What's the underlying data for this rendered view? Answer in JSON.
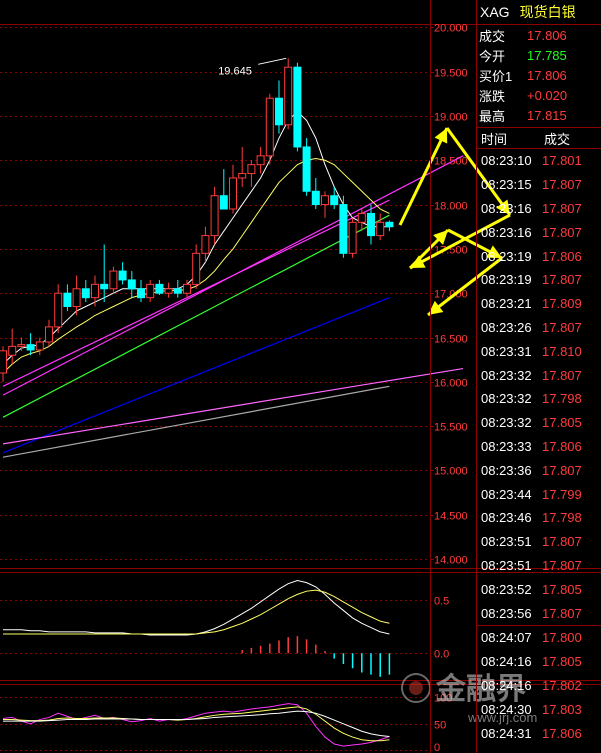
{
  "colors": {
    "background": "#000000",
    "grid": "#8b0000",
    "up_candle": "#ff3b3b",
    "down_candle": "#00ffff",
    "ma5": "#ffffff",
    "ma10": "#ffff66",
    "ma20": "#33ff33",
    "ma40": "#ff33ff",
    "ma60": "#0000ff",
    "ma120": "#ff66ff",
    "ma240": "#aaaaaa",
    "annotation_arrow": "#ffff00",
    "quote_up": "#ff3b3b",
    "quote_green": "#22ff22"
  },
  "header": {
    "symbol": "XAG",
    "name": "现货白银"
  },
  "quote": [
    {
      "label": "成交",
      "value": "17.806",
      "color": "red"
    },
    {
      "label": "今开",
      "value": "17.785",
      "color": "green"
    },
    {
      "label": "买价1",
      "value": "17.806",
      "color": "red"
    },
    {
      "label": "涨跌",
      "value": "+0.020",
      "color": "red"
    },
    {
      "label": "最高",
      "value": "17.815",
      "color": "red"
    }
  ],
  "ticks_header": {
    "time": "时间",
    "price": "成交"
  },
  "ticks": [
    {
      "time": "08:23:10",
      "price": "17.801"
    },
    {
      "time": "08:23:15",
      "price": "17.807"
    },
    {
      "time": "08:23:16",
      "price": "17.807"
    },
    {
      "time": "08:23:16",
      "price": "17.807"
    },
    {
      "time": "08:23:19",
      "price": "17.806"
    },
    {
      "time": "08:23:19",
      "price": "17.807"
    },
    {
      "time": "08:23:21",
      "price": "17.809"
    },
    {
      "time": "08:23:26",
      "price": "17.807"
    },
    {
      "time": "08:23:31",
      "price": "17.810"
    },
    {
      "time": "08:23:32",
      "price": "17.807"
    },
    {
      "time": "08:23:32",
      "price": "17.798"
    },
    {
      "time": "08:23:32",
      "price": "17.805"
    },
    {
      "time": "08:23:33",
      "price": "17.806"
    },
    {
      "time": "08:23:36",
      "price": "17.807"
    },
    {
      "time": "08:23:44",
      "price": "17.799"
    },
    {
      "time": "08:23:46",
      "price": "17.798"
    },
    {
      "time": "08:23:51",
      "price": "17.807"
    },
    {
      "time": "08:23:51",
      "price": "17.807"
    },
    {
      "time": "08:23:52",
      "price": "17.805"
    },
    {
      "time": "08:23:56",
      "price": "17.807"
    },
    {
      "time": "08:24:07",
      "price": "17.800"
    },
    {
      "time": "08:24:16",
      "price": "17.805"
    },
    {
      "time": "08:24:16",
      "price": "17.802"
    },
    {
      "time": "08:24:30",
      "price": "17.803"
    },
    {
      "time": "08:24:31",
      "price": "17.806"
    }
  ],
  "watermark": {
    "text": "金融界",
    "url": "www.jrj.com"
  },
  "chart_data": [
    {
      "type": "candlestick",
      "panel": "price",
      "ylim": [
        13.9,
        20.15
      ],
      "yticks": [
        "20.000",
        "19.500",
        "19.000",
        "18.500",
        "18.000",
        "17.500",
        "17.000",
        "16.500",
        "16.000",
        "15.500",
        "15.000",
        "14.500",
        "14.000"
      ],
      "peak_label": "19.645",
      "candles": [
        {
          "o": 16.1,
          "h": 16.4,
          "l": 16.0,
          "c": 16.35
        },
        {
          "o": 16.3,
          "h": 16.6,
          "l": 16.2,
          "c": 16.4
        },
        {
          "o": 16.4,
          "h": 16.5,
          "l": 16.35,
          "c": 16.42
        },
        {
          "o": 16.42,
          "h": 16.55,
          "l": 16.3,
          "c": 16.36
        },
        {
          "o": 16.36,
          "h": 16.5,
          "l": 16.3,
          "c": 16.45
        },
        {
          "o": 16.45,
          "h": 16.7,
          "l": 16.4,
          "c": 16.62
        },
        {
          "o": 16.62,
          "h": 17.1,
          "l": 16.55,
          "c": 17.0
        },
        {
          "o": 17.0,
          "h": 17.1,
          "l": 16.8,
          "c": 16.85
        },
        {
          "o": 16.85,
          "h": 17.2,
          "l": 16.75,
          "c": 17.05
        },
        {
          "o": 17.05,
          "h": 17.15,
          "l": 16.9,
          "c": 16.95
        },
        {
          "o": 16.95,
          "h": 17.2,
          "l": 16.85,
          "c": 17.1
        },
        {
          "o": 17.1,
          "h": 17.55,
          "l": 16.9,
          "c": 17.05
        },
        {
          "o": 17.05,
          "h": 17.3,
          "l": 17.0,
          "c": 17.25
        },
        {
          "o": 17.25,
          "h": 17.35,
          "l": 17.1,
          "c": 17.15
        },
        {
          "o": 17.15,
          "h": 17.25,
          "l": 16.95,
          "c": 17.05
        },
        {
          "o": 17.05,
          "h": 17.15,
          "l": 16.9,
          "c": 16.95
        },
        {
          "o": 16.95,
          "h": 17.15,
          "l": 16.9,
          "c": 17.1
        },
        {
          "o": 17.1,
          "h": 17.15,
          "l": 16.98,
          "c": 17.0
        },
        {
          "o": 17.0,
          "h": 17.12,
          "l": 16.95,
          "c": 17.05
        },
        {
          "o": 17.05,
          "h": 17.15,
          "l": 16.95,
          "c": 17.0
        },
        {
          "o": 17.0,
          "h": 17.15,
          "l": 16.95,
          "c": 17.1
        },
        {
          "o": 17.1,
          "h": 17.55,
          "l": 17.05,
          "c": 17.45
        },
        {
          "o": 17.45,
          "h": 17.75,
          "l": 17.35,
          "c": 17.65
        },
        {
          "o": 17.65,
          "h": 18.2,
          "l": 17.55,
          "c": 18.1
        },
        {
          "o": 18.1,
          "h": 18.4,
          "l": 17.95,
          "c": 17.95
        },
        {
          "o": 17.95,
          "h": 18.45,
          "l": 17.9,
          "c": 18.3
        },
        {
          "o": 18.3,
          "h": 18.65,
          "l": 18.2,
          "c": 18.35
        },
        {
          "o": 18.35,
          "h": 18.5,
          "l": 18.2,
          "c": 18.45
        },
        {
          "o": 18.45,
          "h": 18.65,
          "l": 18.35,
          "c": 18.55
        },
        {
          "o": 18.55,
          "h": 19.25,
          "l": 18.45,
          "c": 19.2
        },
        {
          "o": 19.2,
          "h": 19.4,
          "l": 18.8,
          "c": 18.9
        },
        {
          "o": 18.9,
          "h": 19.65,
          "l": 18.85,
          "c": 19.55
        },
        {
          "o": 19.55,
          "h": 19.6,
          "l": 18.6,
          "c": 18.65
        },
        {
          "o": 18.65,
          "h": 18.75,
          "l": 18.1,
          "c": 18.15
        },
        {
          "o": 18.15,
          "h": 18.3,
          "l": 17.95,
          "c": 18.0
        },
        {
          "o": 18.0,
          "h": 18.15,
          "l": 17.85,
          "c": 18.1
        },
        {
          "o": 18.1,
          "h": 18.2,
          "l": 17.95,
          "c": 18.0
        },
        {
          "o": 18.0,
          "h": 18.1,
          "l": 17.4,
          "c": 17.45
        },
        {
          "o": 17.45,
          "h": 17.85,
          "l": 17.4,
          "c": 17.8
        },
        {
          "o": 17.8,
          "h": 17.95,
          "l": 17.7,
          "c": 17.9
        },
        {
          "o": 17.9,
          "h": 18.0,
          "l": 17.55,
          "c": 17.65
        },
        {
          "o": 17.65,
          "h": 17.9,
          "l": 17.6,
          "c": 17.8
        },
        {
          "o": 17.8,
          "h": 17.82,
          "l": 17.7,
          "c": 17.75
        }
      ],
      "ma_lines": [
        {
          "color": "ma5",
          "values": [
            16.2,
            16.3,
            16.38,
            16.4,
            16.42,
            16.5,
            16.6,
            16.7,
            16.8,
            16.85,
            16.9,
            16.95,
            17.0,
            17.05,
            17.05,
            17.05,
            17.05,
            17.05,
            17.05,
            17.05,
            17.1,
            17.2,
            17.35,
            17.55,
            17.7,
            17.85,
            18.0,
            18.15,
            18.3,
            18.5,
            18.75,
            18.95,
            19.05,
            18.95,
            18.75,
            18.45,
            18.2,
            18.0,
            17.85,
            17.8,
            17.75,
            17.75,
            17.75
          ]
        },
        {
          "color": "ma10",
          "values": [
            16.1,
            16.2,
            16.28,
            16.32,
            16.35,
            16.4,
            16.48,
            16.55,
            16.62,
            16.68,
            16.75,
            16.8,
            16.85,
            16.9,
            16.95,
            16.98,
            17.0,
            17.02,
            17.03,
            17.03,
            17.04,
            17.08,
            17.15,
            17.25,
            17.38,
            17.5,
            17.65,
            17.8,
            17.95,
            18.1,
            18.25,
            18.35,
            18.45,
            18.5,
            18.52,
            18.5,
            18.45,
            18.35,
            18.25,
            18.15,
            18.05,
            17.95,
            17.9
          ]
        }
      ],
      "trendlines": [
        {
          "color": "ma20",
          "x0": 0,
          "y0": 15.6,
          "x1": 42,
          "y1": 17.88
        },
        {
          "color": "ma40",
          "x0": 0,
          "y0": 15.95,
          "x1": 42,
          "y1": 18.05
        },
        {
          "color": "ma40",
          "x0": 0,
          "y0": 15.85,
          "x1": 50,
          "y1": 18.55
        },
        {
          "color": "ma60",
          "x0": 0,
          "y0": 15.2,
          "x1": 42,
          "y1": 16.95
        },
        {
          "color": "ma120",
          "x0": 0,
          "y0": 15.3,
          "x1": 50,
          "y1": 16.15
        },
        {
          "color": "ma240",
          "x0": 0,
          "y0": 15.15,
          "x1": 42,
          "y1": 15.95
        }
      ]
    },
    {
      "type": "histogram",
      "panel": "macd",
      "ylim": [
        -0.25,
        0.75
      ],
      "yticks": [
        "0.5",
        "0.0"
      ],
      "bars": [
        0,
        0,
        0,
        0,
        0,
        0,
        0,
        0,
        0,
        0,
        0,
        0,
        0,
        0,
        0,
        0,
        0,
        0,
        0,
        0,
        0,
        0,
        0,
        0,
        0,
        0,
        0.03,
        0.05,
        0.07,
        0.09,
        0.12,
        0.15,
        0.16,
        0.13,
        0.08,
        0.02,
        -0.05,
        -0.1,
        -0.14,
        -0.18,
        -0.2,
        -0.22,
        -0.2
      ],
      "lines": [
        {
          "color": "ma5",
          "values": [
            0.22,
            0.22,
            0.22,
            0.21,
            0.21,
            0.2,
            0.2,
            0.2,
            0.2,
            0.2,
            0.19,
            0.19,
            0.19,
            0.19,
            0.18,
            0.18,
            0.17,
            0.17,
            0.17,
            0.17,
            0.17,
            0.18,
            0.2,
            0.23,
            0.27,
            0.32,
            0.37,
            0.42,
            0.48,
            0.54,
            0.6,
            0.65,
            0.68,
            0.66,
            0.62,
            0.55,
            0.47,
            0.4,
            0.33,
            0.28,
            0.24,
            0.2,
            0.18
          ]
        },
        {
          "color": "ma10",
          "values": [
            0.18,
            0.18,
            0.18,
            0.18,
            0.18,
            0.18,
            0.18,
            0.18,
            0.18,
            0.18,
            0.18,
            0.18,
            0.18,
            0.18,
            0.18,
            0.18,
            0.18,
            0.18,
            0.18,
            0.18,
            0.18,
            0.18,
            0.19,
            0.2,
            0.22,
            0.25,
            0.28,
            0.32,
            0.36,
            0.41,
            0.46,
            0.51,
            0.55,
            0.58,
            0.59,
            0.57,
            0.53,
            0.48,
            0.43,
            0.38,
            0.34,
            0.3,
            0.28
          ]
        }
      ]
    },
    {
      "type": "line",
      "panel": "kdj",
      "ylim": [
        -5,
        125
      ],
      "yticks": [
        "100",
        "50",
        "0"
      ],
      "series": [
        {
          "color": "ma40",
          "values": [
            60,
            62,
            55,
            50,
            58,
            62,
            70,
            64,
            58,
            62,
            66,
            60,
            62,
            58,
            54,
            56,
            60,
            55,
            58,
            57,
            60,
            65,
            70,
            72,
            74,
            72,
            75,
            78,
            80,
            82,
            85,
            88,
            86,
            70,
            45,
            25,
            12,
            8,
            10,
            12,
            15,
            20,
            26
          ]
        },
        {
          "color": "ma10",
          "values": [
            58,
            58,
            57,
            56,
            56,
            57,
            60,
            61,
            60,
            60,
            61,
            61,
            61,
            60,
            59,
            58,
            58,
            58,
            58,
            57,
            58,
            60,
            63,
            66,
            68,
            69,
            70,
            72,
            74,
            76,
            78,
            80,
            82,
            78,
            68,
            55,
            42,
            32,
            25,
            20,
            18,
            18,
            20
          ]
        },
        {
          "color": "ma5",
          "values": [
            55,
            55,
            55,
            55,
            55,
            56,
            57,
            58,
            58,
            58,
            59,
            59,
            59,
            59,
            59,
            58,
            58,
            58,
            58,
            58,
            58,
            59,
            60,
            62,
            63,
            64,
            65,
            66,
            67,
            69,
            70,
            72,
            74,
            73,
            70,
            64,
            57,
            50,
            43,
            36,
            31,
            28,
            26
          ]
        }
      ]
    }
  ]
}
